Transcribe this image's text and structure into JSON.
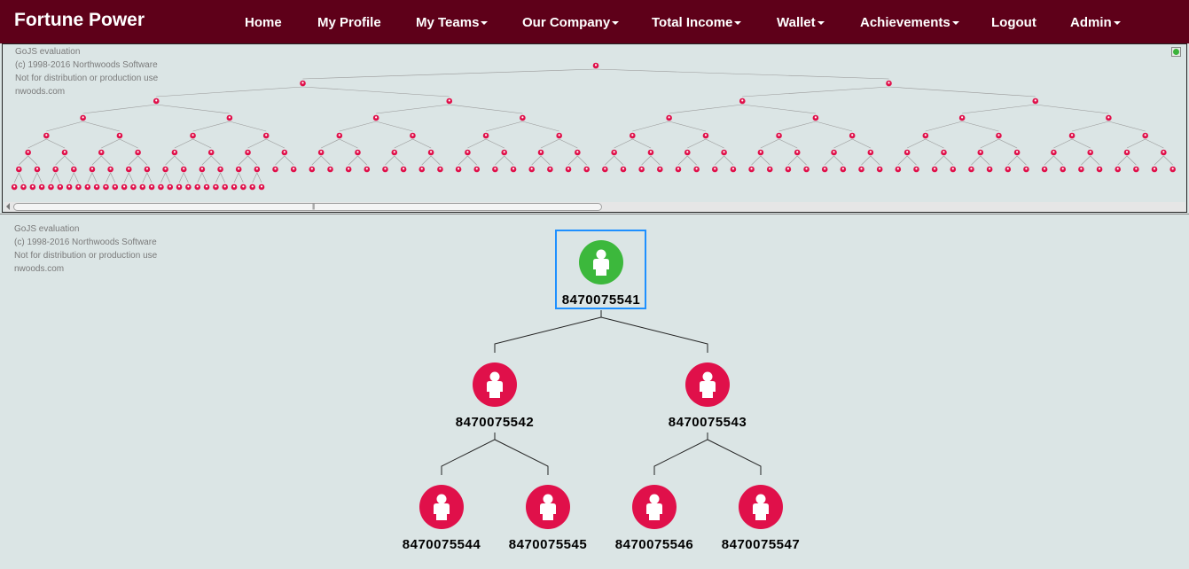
{
  "brand": "Fortune Power",
  "nav": [
    {
      "label": "Home",
      "dropdown": false
    },
    {
      "label": "My Profile",
      "dropdown": false
    },
    {
      "label": "My Teams",
      "dropdown": true
    },
    {
      "label": "Our Company",
      "dropdown": true
    },
    {
      "label": "Total Income",
      "dropdown": true
    },
    {
      "label": "Wallet",
      "dropdown": true
    },
    {
      "label": "Achievements",
      "dropdown": true
    },
    {
      "label": "Logout",
      "dropdown": false
    },
    {
      "label": "Admin",
      "dropdown": true
    }
  ],
  "watermark": {
    "line1": "GoJS evaluation",
    "line2": "(c) 1998-2016 Northwoods Software",
    "line3": "Not for distribution or production use",
    "line4": "nwoods.com"
  },
  "tree": {
    "root": {
      "id": "8470075541",
      "status": "green"
    },
    "level1": [
      {
        "id": "8470075542",
        "status": "red"
      },
      {
        "id": "8470075543",
        "status": "red"
      }
    ],
    "level2": [
      {
        "id": "8470075544",
        "status": "red"
      },
      {
        "id": "8470075545",
        "status": "red"
      },
      {
        "id": "8470075546",
        "status": "red"
      },
      {
        "id": "8470075547",
        "status": "red"
      }
    ]
  },
  "colors": {
    "navbar": "#5e0019",
    "node_red": "#e0104a",
    "node_green": "#3cb83c",
    "selection": "#1e90ff",
    "background": "#dbe5e5"
  },
  "icons": {
    "node": "person-icon",
    "expand": "expand-overview-icon"
  }
}
